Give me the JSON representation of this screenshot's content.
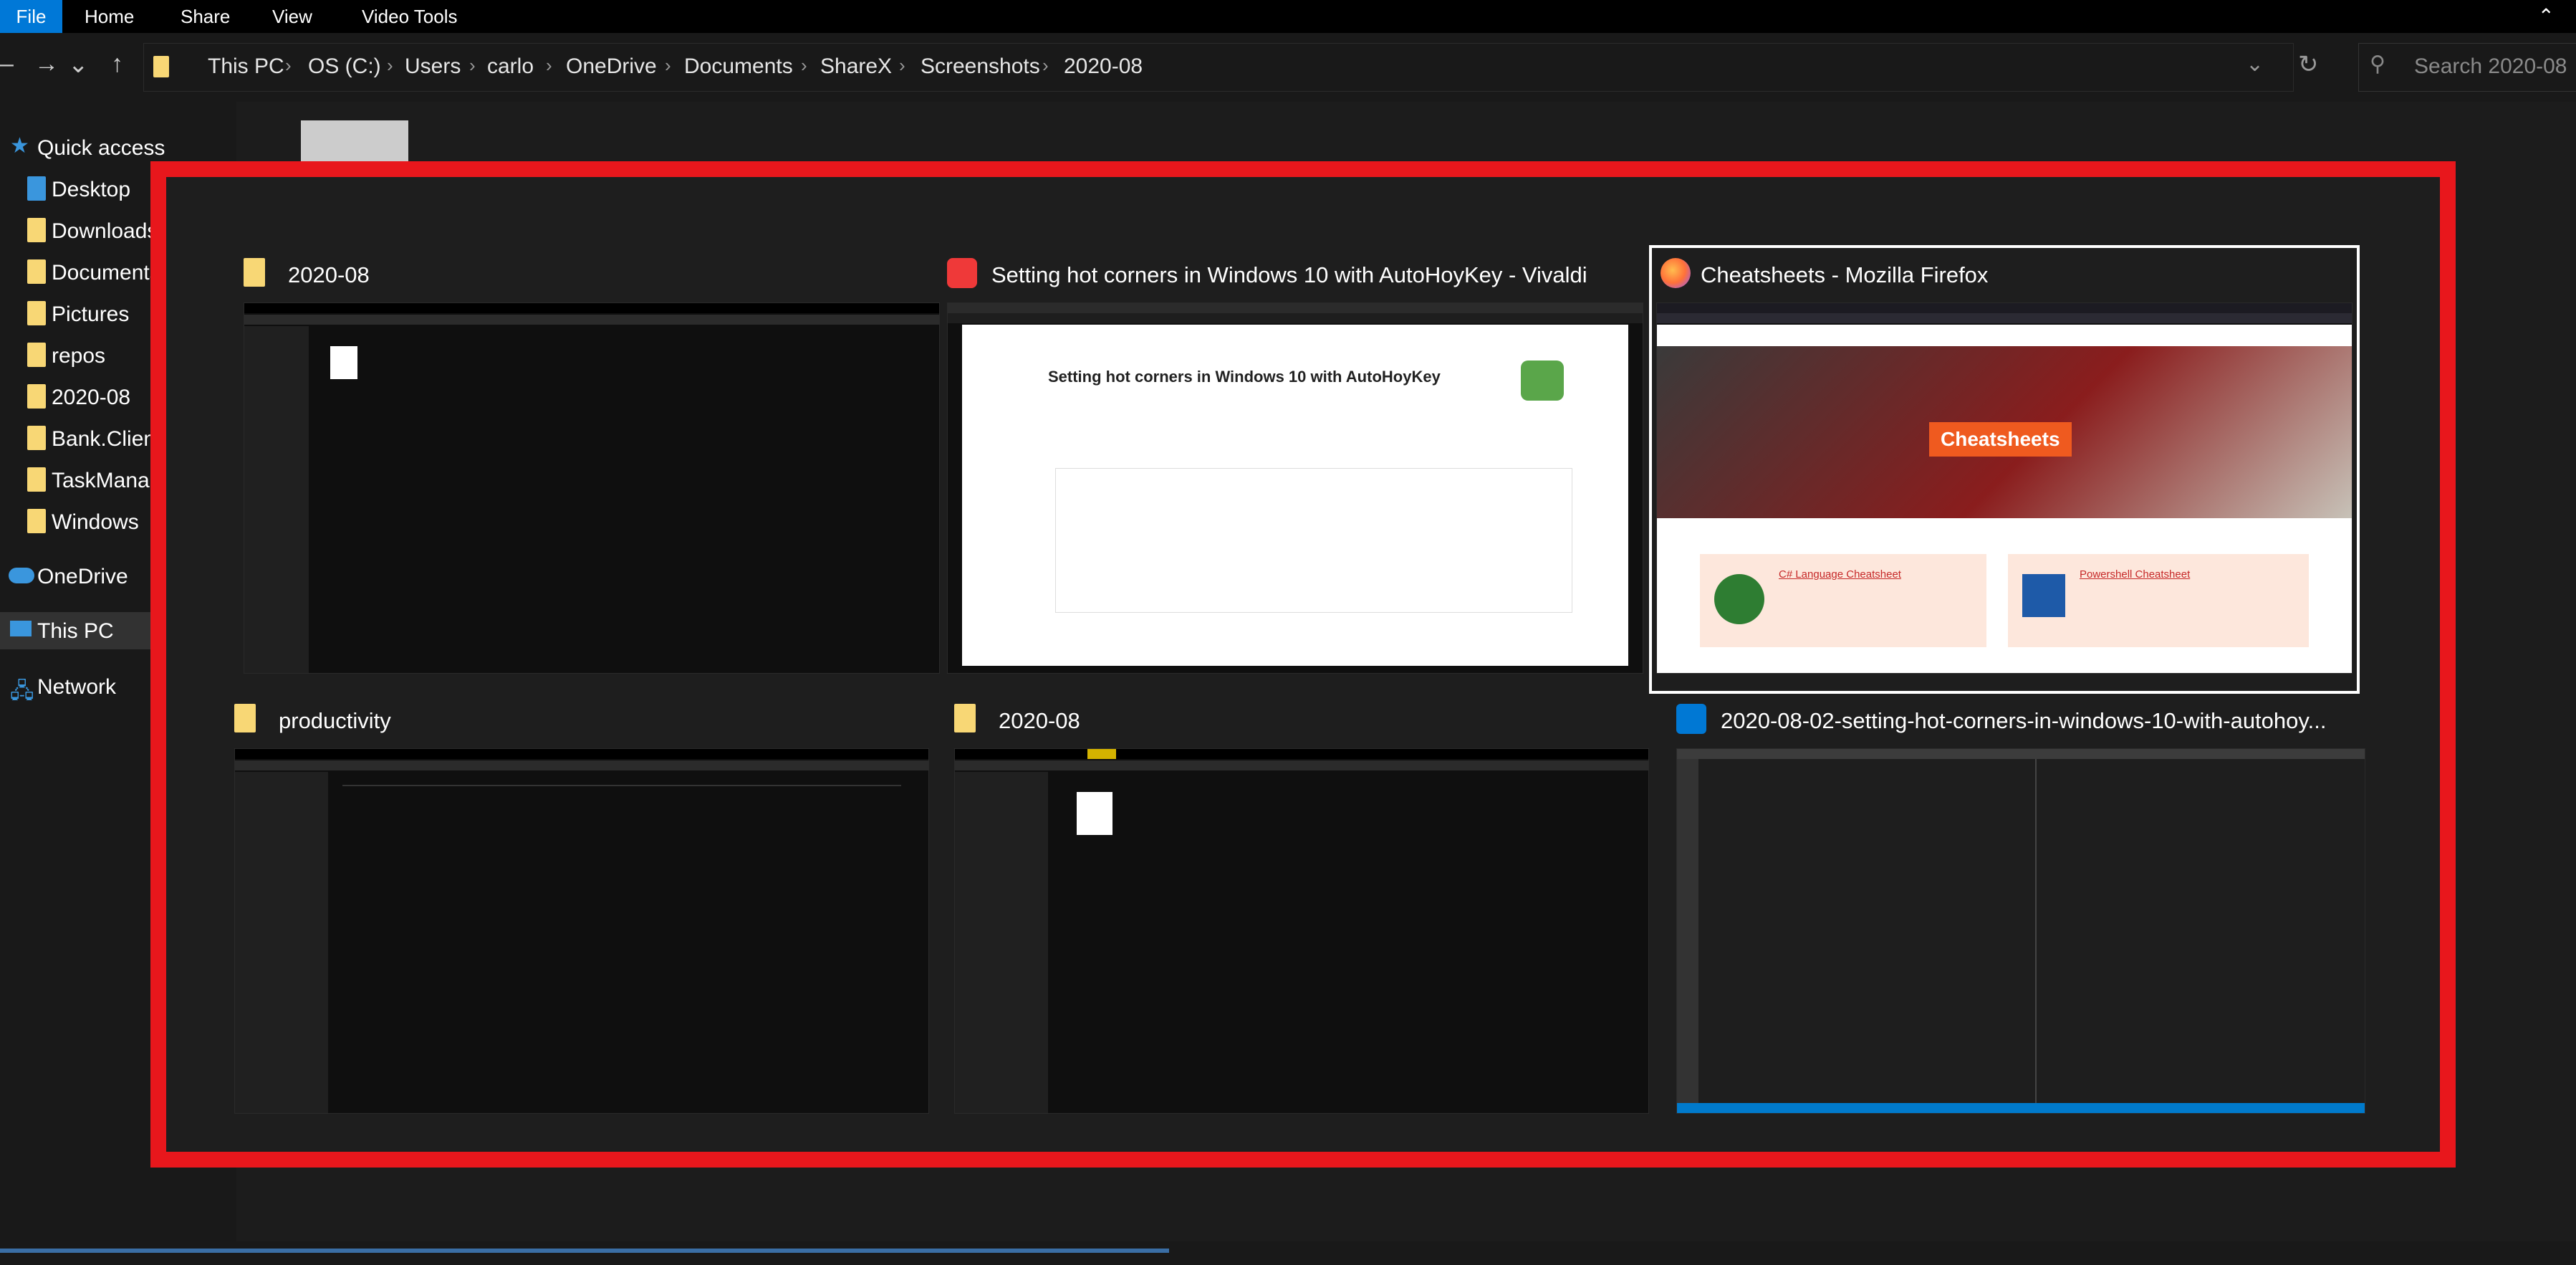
{
  "ribbon": {
    "tabs": [
      "File",
      "Home",
      "Share",
      "View",
      "Video Tools"
    ]
  },
  "addressbar": {
    "crumbs": [
      "This PC",
      "OS (C:)",
      "Users",
      "carlo",
      "OneDrive",
      "Documents",
      "ShareX",
      "Screenshots",
      "2020-08"
    ],
    "search_placeholder": "Search 2020-08"
  },
  "navpane": {
    "items": [
      "Quick access",
      "Desktop",
      "Downloads",
      "Documents",
      "Pictures",
      "repos",
      "2020-08",
      "Bank.Client",
      "TaskManager",
      "Windows",
      "OneDrive",
      "This PC",
      "Network"
    ]
  },
  "taskview": {
    "windows": [
      {
        "title": "2020-08",
        "icon": "folder-icon"
      },
      {
        "title": "Setting hot corners in Windows 10 with AutoHoyKey - Vivaldi",
        "icon": "vivaldi-icon"
      },
      {
        "title": "Cheatsheets - Mozilla Firefox",
        "icon": "firefox-icon"
      },
      {
        "title": "productivity",
        "icon": "folder-icon"
      },
      {
        "title": "2020-08",
        "icon": "folder-icon"
      },
      {
        "title": "2020-08-02-setting-hot-corners-in-windows-10-with-autohoy...",
        "icon": "vscode-icon"
      }
    ],
    "blog_heading": "Setting hot corners in Windows 10 with AutoHoyKey",
    "cheatsheets_banner": "Cheatsheets",
    "cs_card": "C# Language Cheatsheet",
    "ps_card": "Powershell Cheatsheet"
  },
  "colors": {
    "accent": "#0078d7",
    "highlight_border": "#e8171c",
    "background": "#191919"
  }
}
